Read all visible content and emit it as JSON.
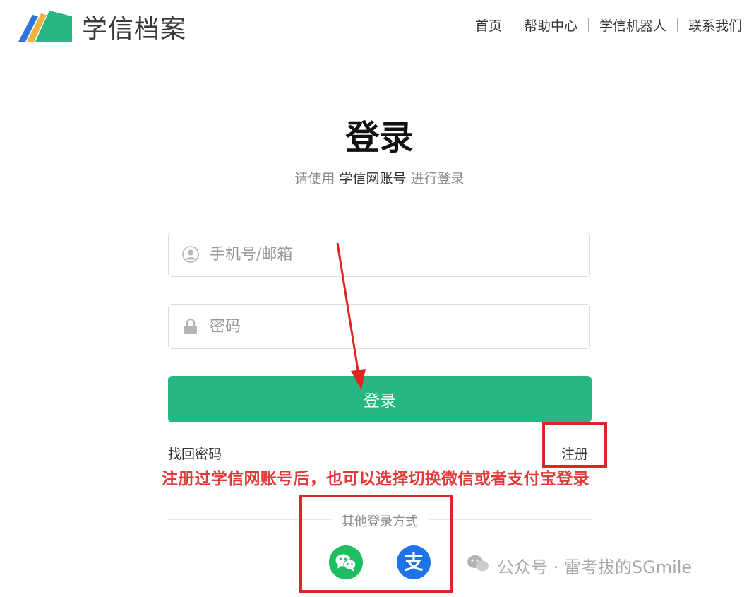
{
  "brand": {
    "name": "学信档案"
  },
  "nav": {
    "items": [
      {
        "label": "首页"
      },
      {
        "label": "帮助中心"
      },
      {
        "label": "学信机器人"
      },
      {
        "label": "联系我们"
      }
    ]
  },
  "login": {
    "title": "登录",
    "subtitle_prefix": "请使用",
    "subtitle_account": "学信网账号",
    "subtitle_suffix": "进行登录",
    "username_placeholder": "手机号/邮箱",
    "password_placeholder": "密码",
    "submit_label": "登录",
    "forgot_label": "找回密码",
    "register_label": "注册",
    "other_methods_label": "其他登录方式"
  },
  "annotation": {
    "note": "注册过学信网账号后，也可以选择切换微信或者支付宝登录",
    "color": "#e02424"
  },
  "other_login": {
    "wechat_icon": "wechat-icon",
    "alipay_icon": "alipay-icon",
    "alipay_glyph": "支",
    "wechat_color": "#1fbd62",
    "alipay_color": "#1d74e8"
  },
  "watermark": {
    "text": "公众号 · 雷考拔的SGmile"
  },
  "colors": {
    "primary": "#27b783",
    "accent_red": "#e02424"
  }
}
